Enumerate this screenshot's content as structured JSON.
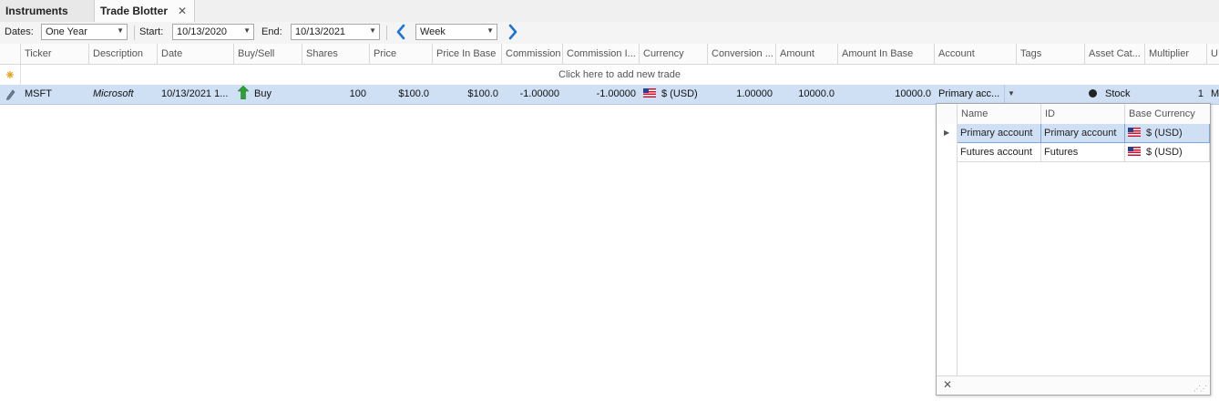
{
  "tabs": [
    {
      "label": "Instruments"
    },
    {
      "label": "Trade Blotter",
      "close": "✕"
    }
  ],
  "toolbar": {
    "dates_label": "Dates:",
    "dates_value": "One Year",
    "start_label": "Start:",
    "start_value": "10/13/2020",
    "end_label": "End:",
    "end_value": "10/13/2021",
    "period_value": "Week"
  },
  "columns": [
    "Ticker",
    "Description",
    "Date",
    "Buy/Sell",
    "Shares",
    "Price",
    "Price In Base",
    "Commission",
    "Commission I...",
    "Currency",
    "Conversion ...",
    "Amount",
    "Amount In Base",
    "Account",
    "Tags",
    "Asset Cat...",
    "Multiplier",
    "U"
  ],
  "new_row_text": "Click here to add new trade",
  "trade": {
    "ticker": "MSFT",
    "description": "Microsoft",
    "date": "10/13/2021 1...",
    "buysell": "Buy",
    "shares": "100",
    "price": "$100.0",
    "price_in_base": "$100.0",
    "commission": "-1.00000",
    "commission_in_base": "-1.00000",
    "currency": "$ (USD)",
    "conversion": "1.00000",
    "amount": "10000.0",
    "amount_in_base": "10000.0",
    "account": "Primary acc...",
    "asset_category": "Stock",
    "multiplier": "1",
    "u": "M"
  },
  "account_popup": {
    "columns": [
      "Name",
      "ID",
      "Base Currency"
    ],
    "rows": [
      {
        "name": "Primary account",
        "id": "Primary account",
        "currency": "$ (USD)",
        "selected": true
      },
      {
        "name": "Futures account",
        "id": "Futures",
        "currency": "$ (USD)",
        "selected": false
      }
    ],
    "close": "✕"
  },
  "colors": {
    "accent": "#1e74d3",
    "selection": "#cfdff4",
    "buy_arrow": "#2e9e36"
  }
}
